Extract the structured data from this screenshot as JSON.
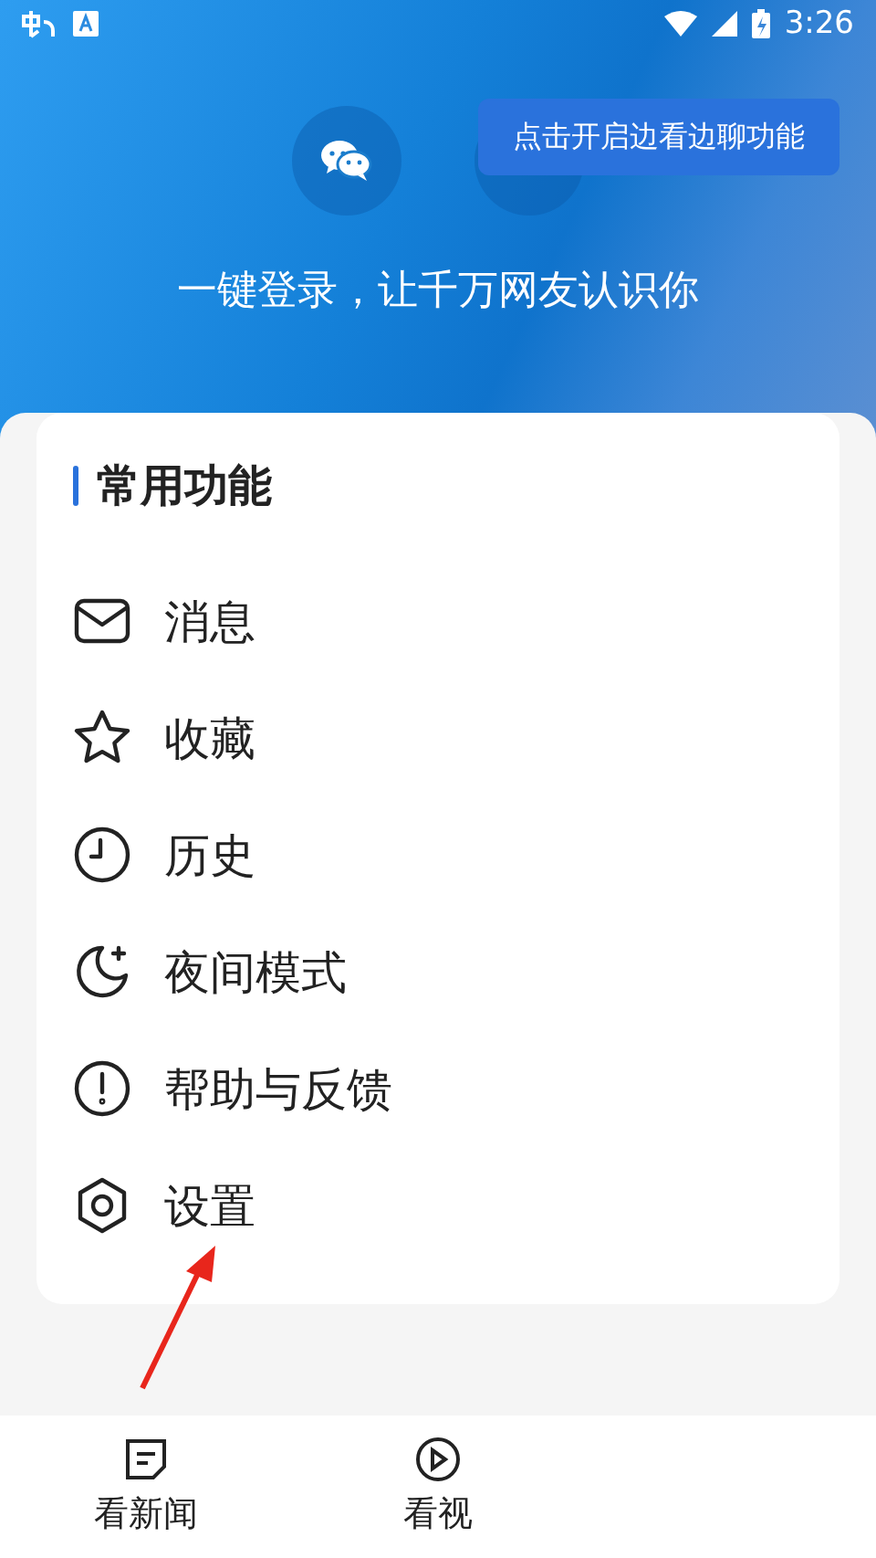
{
  "status_bar": {
    "time": "3:26"
  },
  "header": {
    "subtitle": "一键登录，让千万网友认识你",
    "tooltip": "点击开启边看边聊功能"
  },
  "card": {
    "title": "常用功能",
    "items": [
      {
        "label": "消息",
        "kind": "mail"
      },
      {
        "label": "收藏",
        "kind": "star"
      },
      {
        "label": "历史",
        "kind": "clock"
      },
      {
        "label": "夜间模式",
        "kind": "moon"
      },
      {
        "label": "帮助与反馈",
        "kind": "alert"
      },
      {
        "label": "设置",
        "kind": "settings"
      }
    ]
  },
  "bottom_nav": [
    {
      "label": "看新闻",
      "kind": "news"
    },
    {
      "label": "看视",
      "kind": "video"
    }
  ]
}
